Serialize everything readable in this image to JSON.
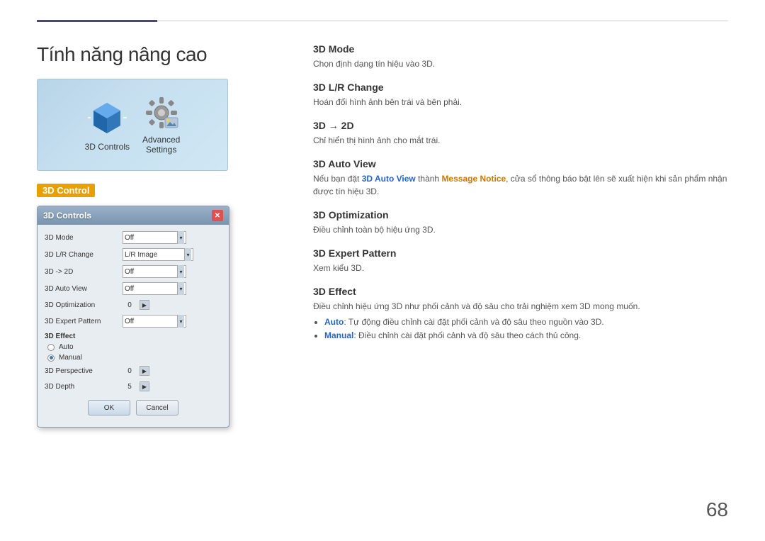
{
  "header": {
    "line1_label": "top-dark-line",
    "line2_label": "top-light-line"
  },
  "left": {
    "title": "Tính năng nâng cao",
    "menu_items": [
      {
        "label": "3D Controls",
        "icon": "3d-controls-icon"
      },
      {
        "label": "Advanced\nSettings",
        "icon": "advanced-settings-icon"
      }
    ],
    "selected_section_label": "3D Control",
    "dialog": {
      "title": "3D Controls",
      "close_label": "✕",
      "rows": [
        {
          "label": "3D Mode",
          "value": "Off",
          "type": "select"
        },
        {
          "label": "3D L/R Change",
          "value": "L/R Image",
          "type": "select"
        },
        {
          "label": "3D -> 2D",
          "value": "Off",
          "type": "select"
        },
        {
          "label": "3D Auto View",
          "value": "Off",
          "type": "select"
        },
        {
          "label": "3D Optimization",
          "value": "0",
          "type": "stepper"
        },
        {
          "label": "3D Expert Pattern",
          "value": "Off",
          "type": "select"
        }
      ],
      "effect_section": "3D Effect",
      "radio_options": [
        {
          "label": "Auto",
          "selected": false
        },
        {
          "label": "Manual",
          "selected": true
        }
      ],
      "stepper_rows": [
        {
          "label": "3D Perspective",
          "value": "0"
        },
        {
          "label": "3D Depth",
          "value": "5"
        }
      ],
      "buttons": [
        {
          "label": "OK",
          "type": "ok"
        },
        {
          "label": "Cancel",
          "type": "cancel"
        }
      ]
    }
  },
  "right": {
    "sections": [
      {
        "heading": "3D Mode",
        "desc": "Chọn định dạng tín hiệu vào 3D."
      },
      {
        "heading": "3D L/R Change",
        "desc": "Hoán đổi hình ảnh bên trái và bên phải."
      },
      {
        "heading": "3D → 2D",
        "desc": "Chỉ hiển thị hình ảnh cho mắt trái."
      },
      {
        "heading": "3D Auto View",
        "desc_before": "Nếu bạn đặt ",
        "highlight1": "3D Auto View",
        "desc_mid": " thành ",
        "highlight2": "Message Notice",
        "desc_after": ", cửa sổ thông báo bật lên sẽ xuất hiện khi sản phẩm nhận được tín hiệu 3D."
      },
      {
        "heading": "3D Optimization",
        "desc": "Điều chỉnh toàn bộ hiệu ứng 3D."
      },
      {
        "heading": "3D Expert Pattern",
        "desc": "Xem kiểu 3D."
      },
      {
        "heading": "3D Effect",
        "desc": "Điều chỉnh hiệu ứng 3D như phối cảnh và độ sâu cho trải nghiệm xem 3D mong muốn.",
        "bullets": [
          {
            "label_highlight": "Auto",
            "text": ": Tự động điều chỉnh cài đặt phối cảnh và độ sâu theo nguồn vào 3D."
          },
          {
            "label_highlight": "Manual",
            "text": ": Điều chỉnh cài đặt phối cảnh và độ sâu theo cách thủ công."
          }
        ]
      }
    ]
  },
  "page_number": "68"
}
